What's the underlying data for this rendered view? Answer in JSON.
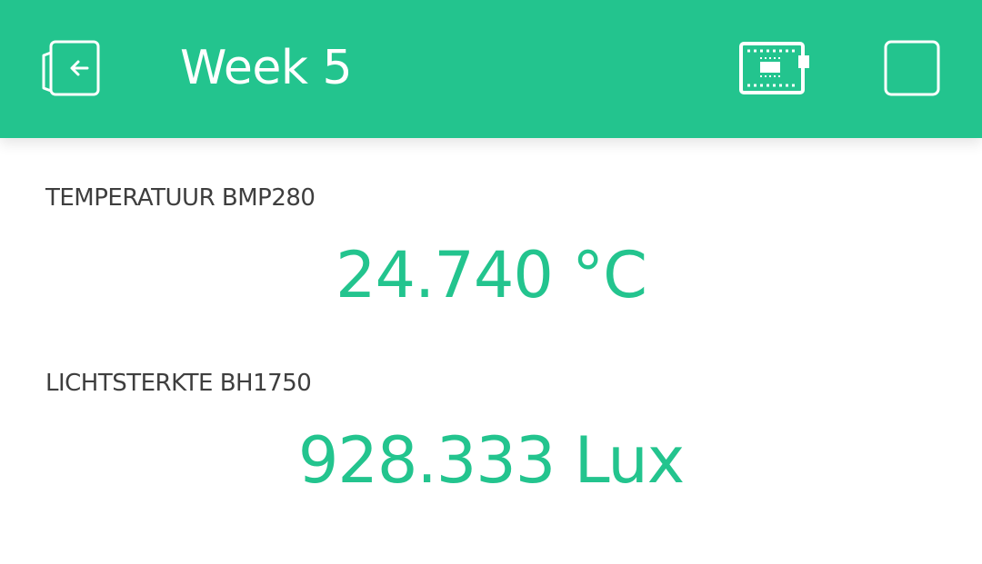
{
  "app_bar": {
    "title": "Week 5",
    "background_color": "#23c48e",
    "back_icon": "exit-door-arrow-left-icon",
    "device_icon": "hardware-board-icon",
    "square_icon": "square-outline-icon"
  },
  "widgets": [
    {
      "label": "TEMPERATUUR BMP280",
      "value": "24.740 °C",
      "color": "#23c48e"
    },
    {
      "label": "LICHTSTERKTE BH1750",
      "value": "928.333 Lux",
      "color": "#23c48e"
    }
  ]
}
